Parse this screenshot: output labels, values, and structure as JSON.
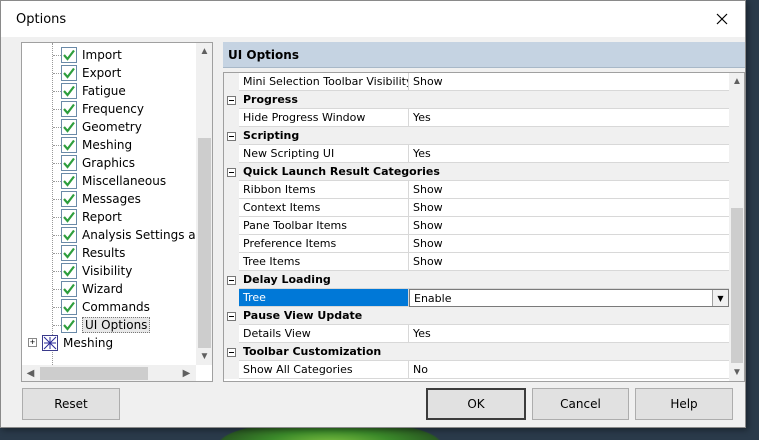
{
  "window": {
    "title": "Options"
  },
  "tree": {
    "items": [
      {
        "label": "Import"
      },
      {
        "label": "Export"
      },
      {
        "label": "Fatigue"
      },
      {
        "label": "Frequency"
      },
      {
        "label": "Geometry"
      },
      {
        "label": "Meshing"
      },
      {
        "label": "Graphics"
      },
      {
        "label": "Miscellaneous"
      },
      {
        "label": "Messages"
      },
      {
        "label": "Report"
      },
      {
        "label": "Analysis Settings and"
      },
      {
        "label": "Results"
      },
      {
        "label": "Visibility"
      },
      {
        "label": "Wizard"
      },
      {
        "label": "Commands"
      },
      {
        "label": "UI Options"
      }
    ],
    "root_item": {
      "label": "Meshing"
    },
    "selected": "UI Options"
  },
  "panel": {
    "header": "UI Options"
  },
  "grid": {
    "rows": [
      {
        "kind": "prop",
        "name": "Mini Selection Toolbar Visibility",
        "value": "Show"
      },
      {
        "kind": "cat",
        "name": "Progress"
      },
      {
        "kind": "prop",
        "name": "Hide Progress Window",
        "value": "Yes"
      },
      {
        "kind": "cat",
        "name": "Scripting"
      },
      {
        "kind": "prop",
        "name": "New Scripting UI",
        "value": "Yes"
      },
      {
        "kind": "cat",
        "name": "Quick Launch Result Categories"
      },
      {
        "kind": "prop",
        "name": "Ribbon Items",
        "value": "Show"
      },
      {
        "kind": "prop",
        "name": "Context Items",
        "value": "Show"
      },
      {
        "kind": "prop",
        "name": "Pane Toolbar Items",
        "value": "Show"
      },
      {
        "kind": "prop",
        "name": "Preference Items",
        "value": "Show"
      },
      {
        "kind": "prop",
        "name": "Tree Items",
        "value": "Show"
      },
      {
        "kind": "cat",
        "name": "Delay Loading"
      },
      {
        "kind": "prop",
        "name": "Tree",
        "value": "Enable",
        "selected": true
      },
      {
        "kind": "cat",
        "name": "Pause View Update"
      },
      {
        "kind": "prop",
        "name": "Details View",
        "value": "Yes"
      },
      {
        "kind": "cat",
        "name": "Toolbar Customization"
      },
      {
        "kind": "prop",
        "name": "Show All Categories",
        "value": "No"
      }
    ]
  },
  "buttons": {
    "reset": "Reset",
    "ok": "OK",
    "cancel": "Cancel",
    "help": "Help"
  },
  "colors": {
    "selection": "#0078d7",
    "header_bg": "#c5d3e2",
    "check_green": "#2e9e3e"
  },
  "icons": {
    "close": "close-icon",
    "check": "green-check-icon",
    "mesh": "meshing-icon"
  }
}
